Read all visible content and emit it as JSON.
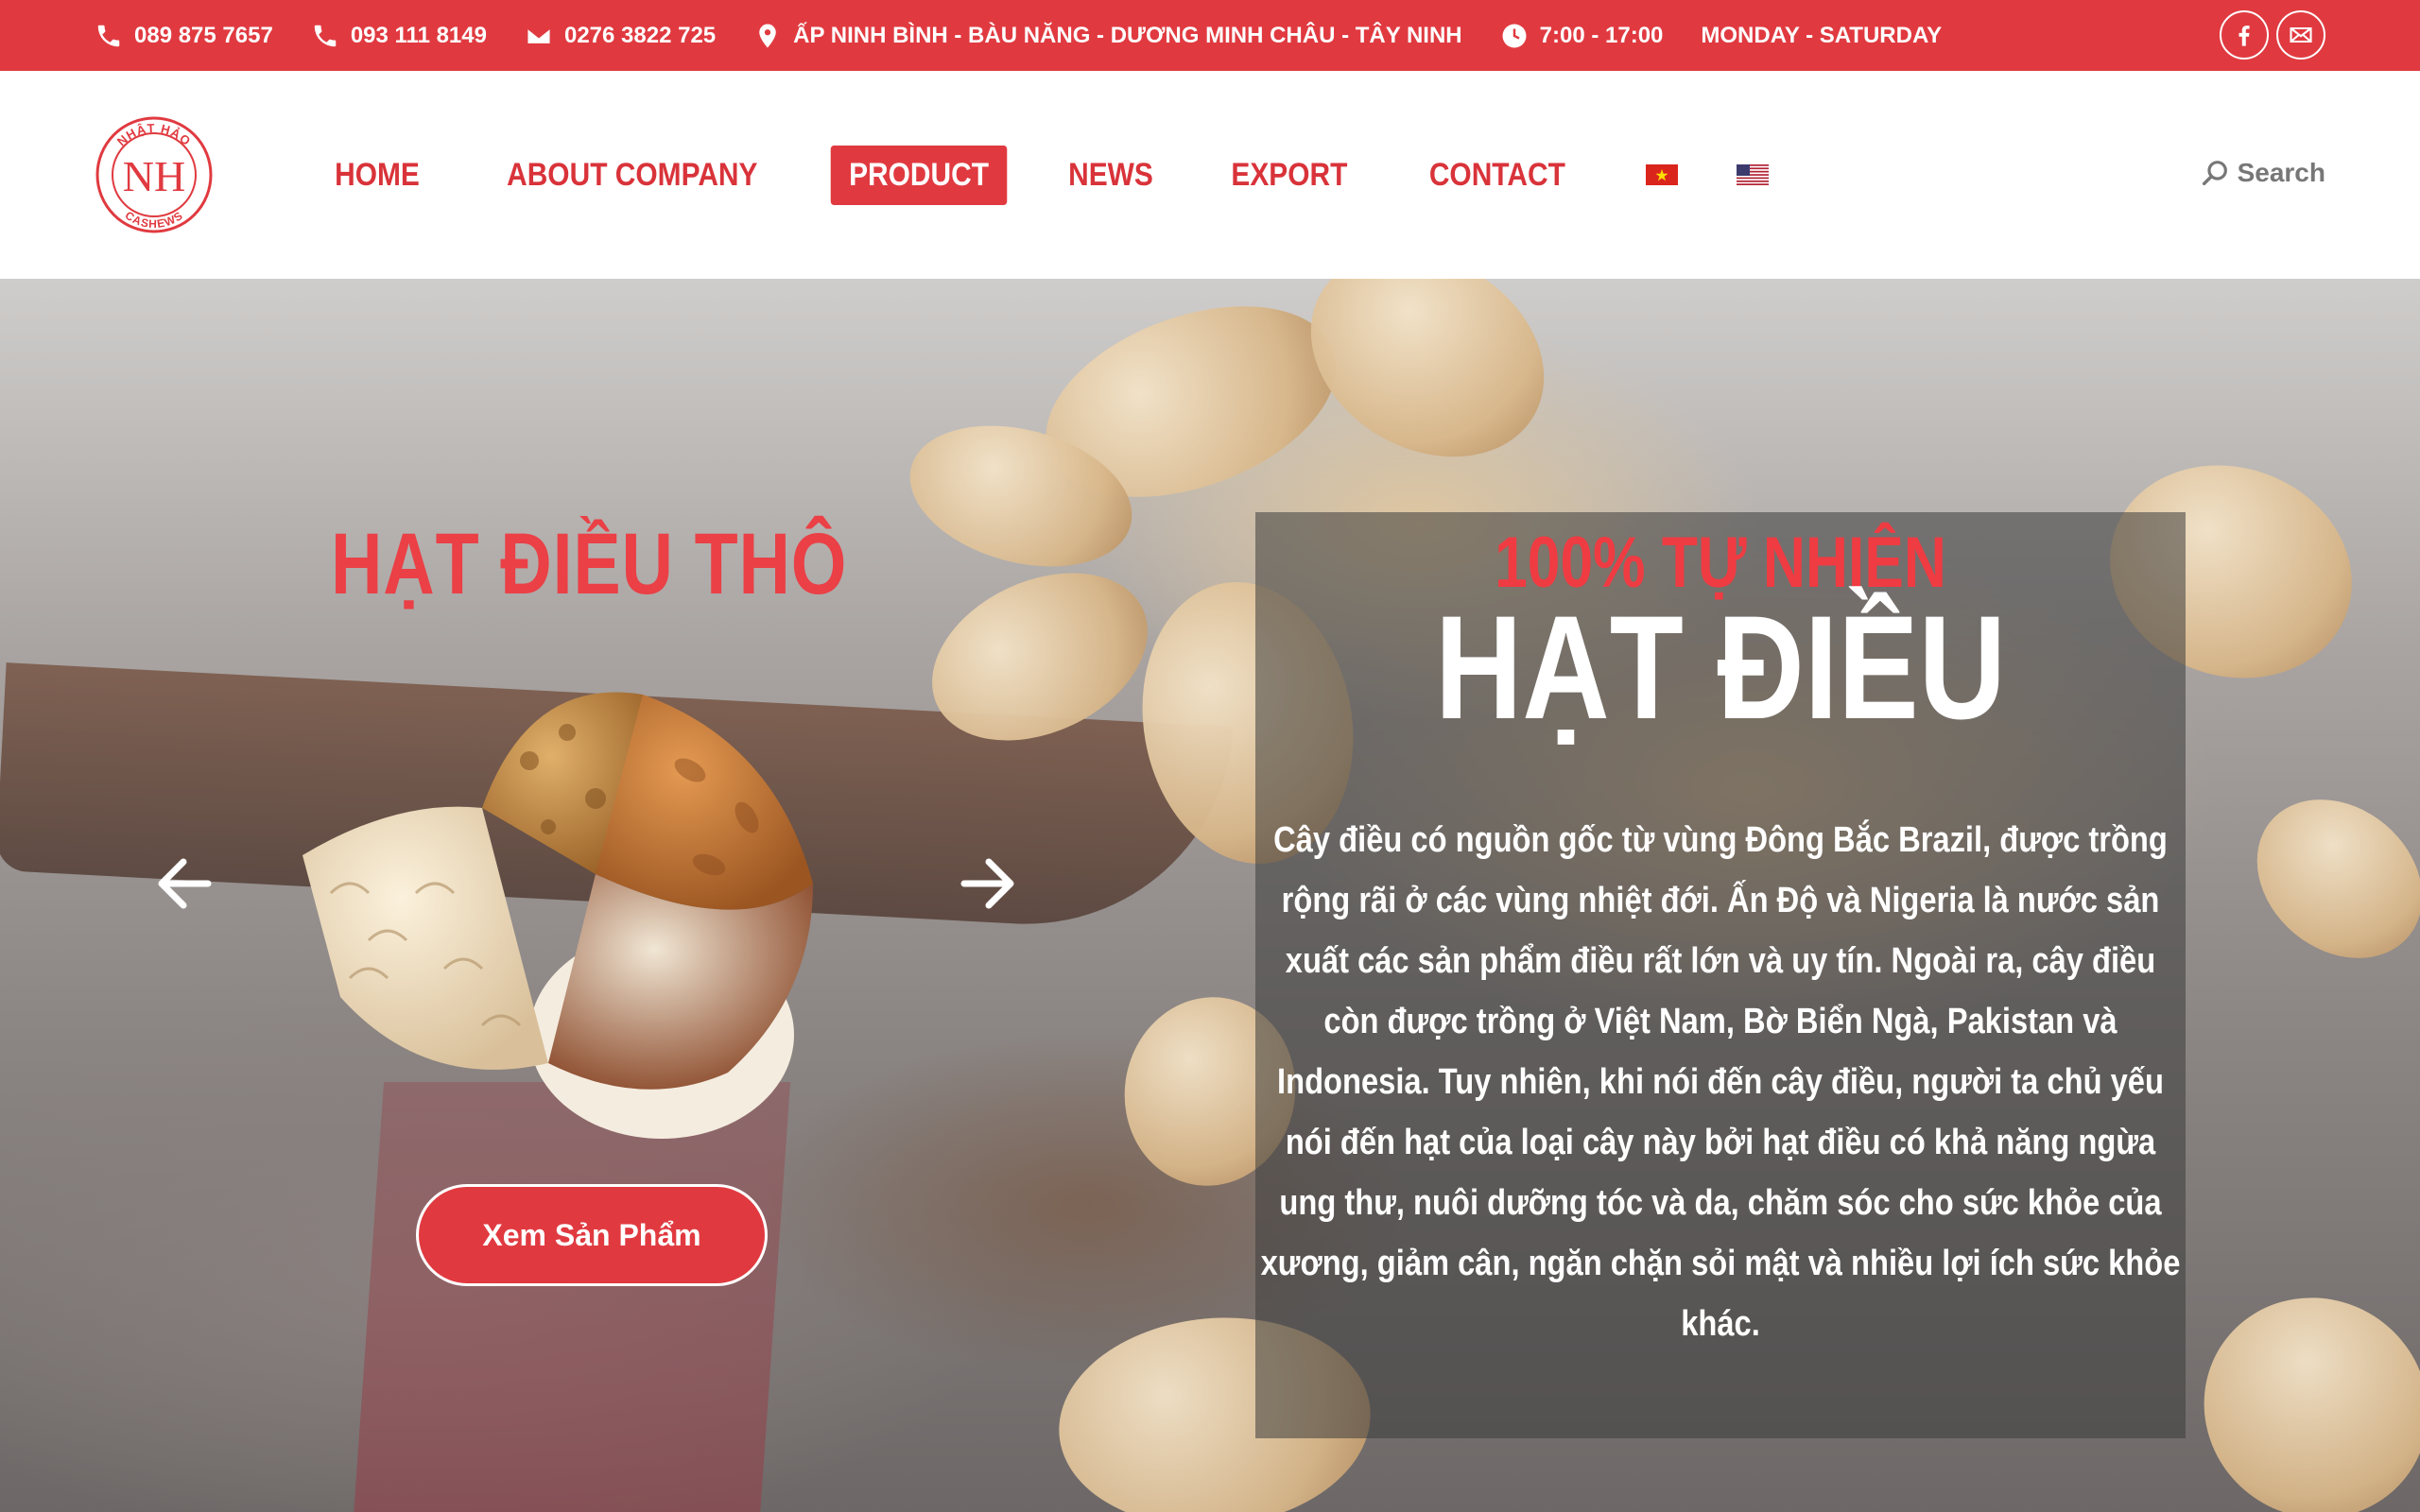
{
  "topbar": {
    "phone1": "089 875 7657",
    "phone2": "093 111 8149",
    "fax": "0276 3822 725",
    "address": "ẤP NINH BÌNH - BÀU NĂNG - DƯƠNG MINH CHÂU - TÂY NINH",
    "hours": "7:00 - 17:00",
    "days": "MONDAY - SATURDAY",
    "social": [
      "facebook-icon",
      "mail-icon"
    ]
  },
  "header": {
    "logo_top": "NHẬT HẢO",
    "logo_mark": "NH",
    "logo_bottom": "CASHEWS",
    "nav": [
      "HOME",
      "ABOUT COMPANY",
      "PRODUCT",
      "NEWS",
      "EXPORT",
      "CONTACT"
    ],
    "active_nav": "PRODUCT",
    "flags": [
      "vietnam-flag-icon",
      "usa-flag-icon"
    ],
    "search_label": "Search"
  },
  "hero": {
    "left_title": "HẠT ĐIỀU THÔ",
    "cta_label": "Xem Sản Phẩm",
    "panel_subtitle": "100% TỰ NHIÊN",
    "panel_title": "HẠT ĐIỀU",
    "panel_body": "Cây điều có nguồn gốc từ vùng Đông Bắc Brazil, được trồng rộng rãi ở các vùng nhiệt đới. Ấn Độ và Nigeria là nước sản xuất các sản phẩm điều rất lớn và uy tín. Ngoài ra, cây điều còn được trồng ở Việt Nam, Bờ Biển Ngà, Pakistan và Indonesia. Tuy nhiên, khi nói đến cây điều, người ta chủ yếu nói đến hạt của loại cây này bởi hạt điều có khả năng ngừa ung thư, nuôi dưỡng tóc và da, chăm sóc cho sức khỏe của xương, giảm cân, ngăn chặn sỏi mật và nhiều lợi ích sức khỏe khác."
  },
  "colors": {
    "brand_red": "#e03a40",
    "nav_red": "#d9333a",
    "panel_overlay": "rgba(60,60,60,0.55)"
  }
}
